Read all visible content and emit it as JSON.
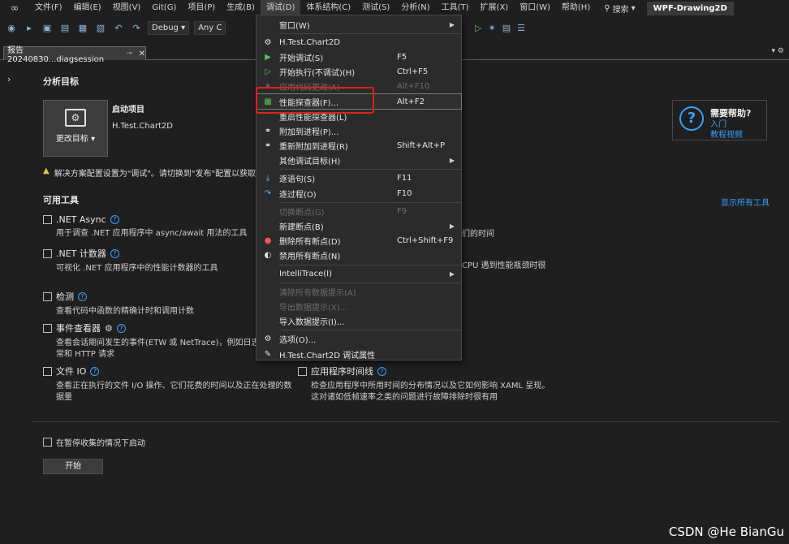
{
  "menubar": {
    "items": [
      "文件(F)",
      "编辑(E)",
      "视图(V)",
      "Git(G)",
      "项目(P)",
      "生成(B)",
      "调试(D)",
      "体系结构(C)",
      "测试(S)",
      "分析(N)",
      "工具(T)",
      "扩展(X)",
      "窗口(W)",
      "帮助(H)"
    ],
    "search_label": "搜索",
    "project_title": "WPF-Drawing2D"
  },
  "toolbar": {
    "config": "Debug",
    "platform": "Any C"
  },
  "tab": {
    "title": "报告20240830...diagsession"
  },
  "main": {
    "section_target": "分析目标",
    "change_target_label": "更改目标",
    "startup_title": "启动项目",
    "startup_value": "H.Test.Chart2D",
    "warning": "解决方案配置设置为\"调试\"。请切换到\"发布\"配置以获取更",
    "help": {
      "title": "需要帮助?",
      "link1": "入门",
      "link2": "教程视频"
    },
    "section_tools": "可用工具",
    "show_all_tools": "显示所有工具",
    "tools": [
      {
        "name": ".NET Async",
        "desc": "用于调查 .NET 应用程序中 async/await 用法的工具"
      },
      {
        "name": ".NET 计数器",
        "desc": "可视化 .NET 应用程序中的性能计数器的工具"
      },
      {
        "name": "检测",
        "desc": "查看代码中函数的精确计时和调用计数"
      },
      {
        "name": "事件查看器",
        "desc": "查看会话期间发生的事件(ETW 或 NetTrace)，例如日志",
        "desc2": "常和 HTTP 请求"
      },
      {
        "name": "文件 IO",
        "desc": "查看正在执行的文件 I/O 操作、它们花费的时间以及正在处理的数",
        "desc2": "据量"
      },
      {
        "name": "应用程序时间线",
        "desc": "检查应用程序中所用时间的分布情况以及它如何影响 XAML 呈现。",
        "desc2": "这对诸如低帧速率之类的问题进行故障排除时很有用"
      }
    ],
    "covered_text_1": "们的时间",
    "covered_text_2": "CPU 遇到性能瓶颈时很",
    "paused_label": "在暂停收集的情况下启动",
    "start_button": "开始"
  },
  "debug_menu": {
    "items": [
      {
        "icon": "",
        "label": "窗口(W)",
        "shortcut": "",
        "submenu": true,
        "disabled": false
      },
      {
        "sep": true
      },
      {
        "icon": "gear-icon",
        "label": "H.Test.Chart2D",
        "shortcut": "",
        "submenu": false,
        "disabled": false
      },
      {
        "icon": "play-icon",
        "label": "开始调试(S)",
        "shortcut": "F5",
        "submenu": false,
        "disabled": false
      },
      {
        "icon": "play-outline-icon",
        "label": "开始执行(不调试)(H)",
        "shortcut": "Ctrl+F5",
        "submenu": false,
        "disabled": false
      },
      {
        "icon": "flame-icon",
        "label": "应用代码更改(A)",
        "shortcut": "Alt+F10",
        "submenu": false,
        "disabled": true
      },
      {
        "icon": "perf-icon",
        "label": "性能探查器(F)...",
        "shortcut": "Alt+F2",
        "submenu": false,
        "disabled": false,
        "highlight": true
      },
      {
        "icon": "",
        "label": "重启性能探查器(L)",
        "shortcut": "",
        "submenu": false,
        "disabled": false
      },
      {
        "icon": "attach-icon",
        "label": "附加到进程(P)...",
        "shortcut": "",
        "submenu": false,
        "disabled": false
      },
      {
        "icon": "reattach-icon",
        "label": "重新附加到进程(R)",
        "shortcut": "Shift+Alt+P",
        "submenu": false,
        "disabled": false
      },
      {
        "icon": "",
        "label": "其他调试目标(H)",
        "shortcut": "",
        "submenu": true,
        "disabled": false
      },
      {
        "sep": true
      },
      {
        "icon": "step-into-icon",
        "label": "逐语句(S)",
        "shortcut": "F11",
        "submenu": false,
        "disabled": false
      },
      {
        "icon": "step-over-icon",
        "label": "逐过程(O)",
        "shortcut": "F10",
        "submenu": false,
        "disabled": false
      },
      {
        "sep": true
      },
      {
        "icon": "",
        "label": "切换断点(G)",
        "shortcut": "F9",
        "submenu": false,
        "disabled": true
      },
      {
        "icon": "",
        "label": "新建断点(B)",
        "shortcut": "",
        "submenu": true,
        "disabled": false
      },
      {
        "icon": "delete-breakpoints-icon",
        "label": "删除所有断点(D)",
        "shortcut": "Ctrl+Shift+F9",
        "submenu": false,
        "disabled": false
      },
      {
        "icon": "disable-breakpoints-icon",
        "label": "禁用所有断点(N)",
        "shortcut": "",
        "submenu": false,
        "disabled": false
      },
      {
        "sep": true
      },
      {
        "icon": "",
        "label": "IntelliTrace(I)",
        "shortcut": "",
        "submenu": true,
        "disabled": false
      },
      {
        "sep": true
      },
      {
        "icon": "",
        "label": "清除所有数据提示(A)",
        "shortcut": "",
        "submenu": false,
        "disabled": true
      },
      {
        "icon": "",
        "label": "导出数据提示(X)...",
        "shortcut": "",
        "submenu": false,
        "disabled": true
      },
      {
        "icon": "",
        "label": "导入数据提示(I)...",
        "shortcut": "",
        "submenu": false,
        "disabled": false
      },
      {
        "sep": true
      },
      {
        "icon": "gear-icon",
        "label": "选项(O)...",
        "shortcut": "",
        "submenu": false,
        "disabled": false
      },
      {
        "icon": "wrench-icon",
        "label": "H.Test.Chart2D 调试属性",
        "shortcut": "",
        "submenu": false,
        "disabled": false
      }
    ]
  },
  "watermark": "CSDN @He BianGu"
}
